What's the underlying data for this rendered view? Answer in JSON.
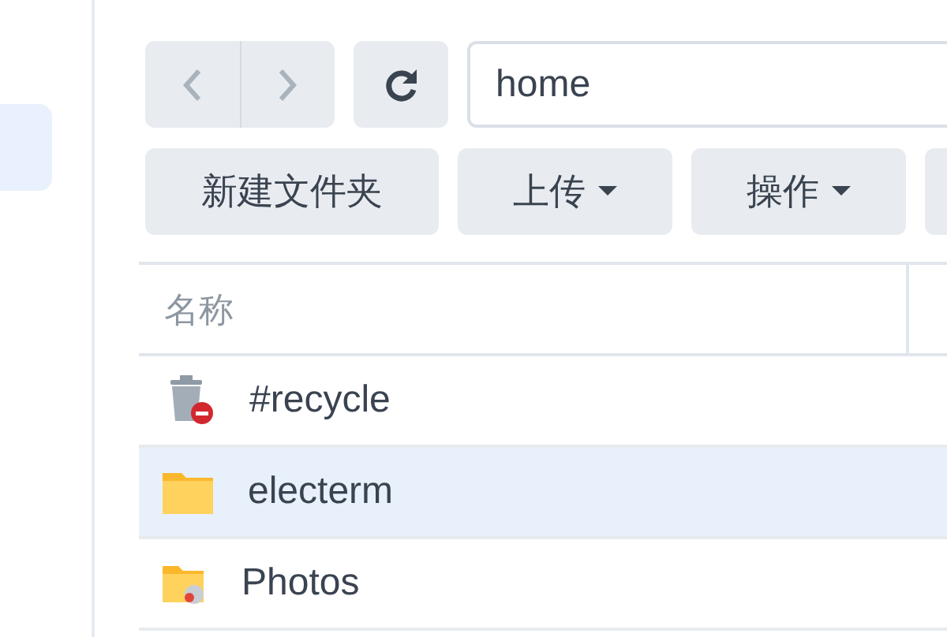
{
  "sidebar": {
    "items": [
      {
        "selected": true
      }
    ]
  },
  "toolbar": {
    "path": "home",
    "buttons": [
      {
        "label": "新建文件夹",
        "dropdown": false
      },
      {
        "label": "上传",
        "dropdown": true
      },
      {
        "label": "操作",
        "dropdown": true
      }
    ]
  },
  "table": {
    "columns": [
      "名称"
    ],
    "rows": [
      {
        "kind": "recycle",
        "name": "#recycle",
        "selected": false
      },
      {
        "kind": "folder",
        "name": "electerm",
        "selected": true
      },
      {
        "kind": "shared",
        "name": "Photos",
        "selected": false
      }
    ]
  }
}
